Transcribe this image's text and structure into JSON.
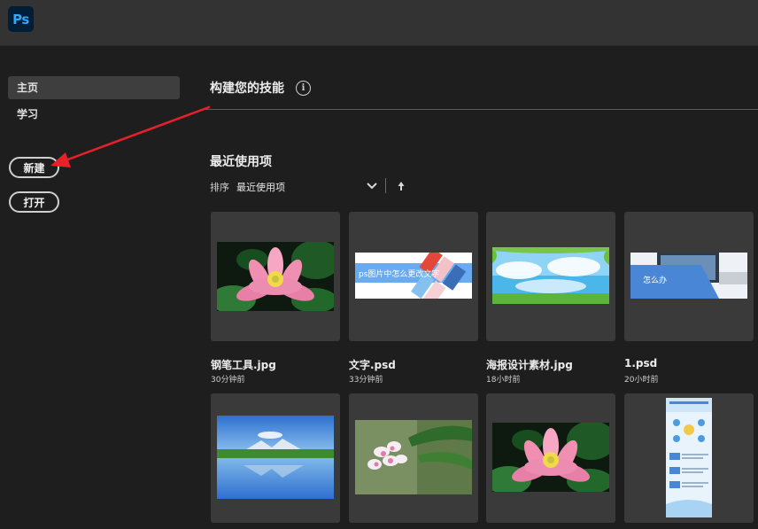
{
  "app": {
    "logo_text": "Ps",
    "brand_color": "#31a8ff",
    "logo_bg": "#001e36"
  },
  "sidebar": {
    "items": [
      {
        "label": "主页",
        "active": true
      },
      {
        "label": "学习",
        "active": false
      }
    ],
    "new_button": "新建",
    "open_button": "打开"
  },
  "main": {
    "skills_title": "构建您的技能",
    "info_icon": "info-icon",
    "recent_title": "最近使用项",
    "sort": {
      "label": "排序",
      "value": "最近使用项",
      "dropdown_icon": "chevron-down-icon",
      "direction_icon": "sort-up-arrow-icon"
    },
    "recent_items": [
      {
        "name": "钢笔工具.jpg",
        "time": "30分钟前",
        "thumb": "pink-lotus"
      },
      {
        "name": "文字.psd",
        "time": "33分钟前",
        "thumb": "text-banner",
        "thumb_text": "ps图片中怎么更改文字"
      },
      {
        "name": "海报设计素材.jpg",
        "time": "18小时前",
        "thumb": "sky-poster"
      },
      {
        "name": "1.psd",
        "time": "20小时前",
        "thumb": "laptop-banner",
        "thumb_text": "怎么办"
      },
      {
        "thumb": "lake-landscape"
      },
      {
        "thumb": "white-flowers"
      },
      {
        "thumb": "pink-lotus"
      },
      {
        "thumb": "infographic-poster"
      }
    ]
  },
  "annotation": {
    "arrow_color": "#e8202a"
  }
}
